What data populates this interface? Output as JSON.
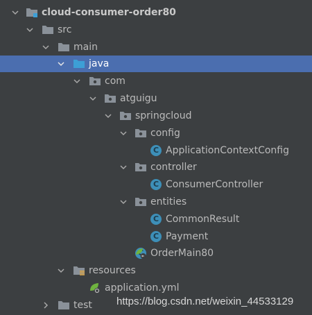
{
  "project_tree": {
    "root": {
      "label": "cloud-consumer-order80",
      "icon": "module-folder-icon"
    },
    "src": {
      "label": "src",
      "icon": "folder-icon"
    },
    "main": {
      "label": "main",
      "icon": "folder-icon"
    },
    "java": {
      "label": "java",
      "icon": "source-root-folder-icon",
      "selected": true
    },
    "com": {
      "label": "com",
      "icon": "package-icon"
    },
    "atguigu": {
      "label": "atguigu",
      "icon": "package-icon"
    },
    "springcloud": {
      "label": "springcloud",
      "icon": "package-icon"
    },
    "config": {
      "label": "config",
      "icon": "package-icon"
    },
    "application_context_config": {
      "label": "ApplicationContextConfig",
      "icon": "class-icon"
    },
    "controller": {
      "label": "controller",
      "icon": "package-icon"
    },
    "consumer_controller": {
      "label": "ConsumerController",
      "icon": "class-icon"
    },
    "entities": {
      "label": "entities",
      "icon": "package-icon"
    },
    "common_result": {
      "label": "CommonResult",
      "icon": "class-icon"
    },
    "payment": {
      "label": "Payment",
      "icon": "class-icon"
    },
    "order_main80": {
      "label": "OrderMain80",
      "icon": "spring-boot-class-icon"
    },
    "resources": {
      "label": "resources",
      "icon": "resources-folder-icon"
    },
    "application_yml": {
      "label": "application.yml",
      "icon": "spring-yml-icon"
    },
    "test": {
      "label": "test",
      "icon": "folder-icon"
    }
  },
  "watermark": {
    "text": "https://blog.csdn.net/weixin_44533129"
  },
  "colors": {
    "background": "#3c3f41",
    "selection": "#4b6eaf",
    "text": "#bbbbbb",
    "folder": "#8a9199",
    "source_folder": "#3d9fd6",
    "class_icon": "#3d8fb8",
    "spring_green": "#6fb33f"
  }
}
